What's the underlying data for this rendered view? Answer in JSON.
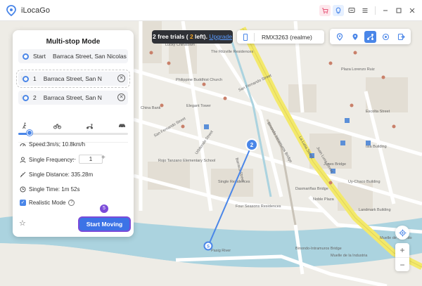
{
  "app": {
    "title": "iLocaGo"
  },
  "titlebar": {
    "icons": [
      "cart-icon",
      "bulb-icon",
      "support-icon",
      "menu-icon",
      "minimize-icon",
      "maximize-icon",
      "close-icon"
    ]
  },
  "toast": {
    "prefix": "2 free trials ( ",
    "count": "2",
    "suffix": " left). ",
    "link": "Upgrade"
  },
  "device": {
    "name": "RMX3263 (realme)"
  },
  "toolbar": {
    "tools": [
      "pin-icon",
      "location-icon",
      "multi-stop-icon",
      "joystick-icon",
      "export-icon"
    ]
  },
  "panel": {
    "title": "Multi-stop Mode",
    "start": {
      "tag": "Start",
      "address": "Barraca Street, San Nicolas"
    },
    "stops": [
      {
        "num": "1",
        "address": "Barraca Street, San N"
      },
      {
        "num": "2",
        "address": "Barraca Street, San N"
      }
    ],
    "speed": "Speed:3m/s; 10.8km/h",
    "frequency_label": "Single Frequency:",
    "frequency_value": "1",
    "distance": "Single Distance: 335.28m",
    "time": "Single Time: 1m 52s",
    "realistic": "Realistic Mode",
    "start_button": "Start Moving",
    "step_badge": "5",
    "speed_level": 0.1
  },
  "map": {
    "markers": [
      "2",
      "S"
    ],
    "labels": [
      "Philippine Buddhist Church",
      "The Ritzville Residences",
      "Elegant Tower",
      "San Fernando Street",
      "Binondo Intramuros Bridge",
      "Barraca Street",
      "San Fernando Street",
      "Urbitondo Street",
      "Rojo Tanzano Elementary School",
      "Single Residences",
      "Four Seasons Residences",
      "Dasmariñas Bridge",
      "Noble Plaza",
      "Binondo-Intramuros Bridge",
      "Pasig River",
      "Jones Bridge",
      "La Luna Street",
      "Juan Luna Street",
      "Muelle de la Industria",
      "Uy-Chaco Building",
      "Landmark Building",
      "Escolta Street",
      "Muelle de Binondo",
      "Plaza Lorenzo Ruiz",
      "China Bank",
      "Lucky Chinatown",
      "Isla Building"
    ]
  },
  "colors": {
    "accent": "#4a86e8",
    "highlight": "#7b4bd9",
    "button": "#3c73e6",
    "toast_bg": "#2f3136",
    "map_bg": "#eeece6",
    "road_yellow": "#f3e96b",
    "river": "#abd3df"
  }
}
